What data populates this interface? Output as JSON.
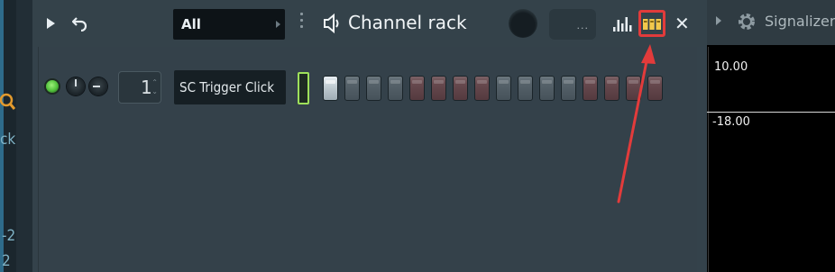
{
  "left_panel": {
    "partial_text_top": "ck",
    "partial_text_a": "-2",
    "partial_text_b": "2"
  },
  "channel_rack": {
    "filter_value": "All",
    "title": "Channel rack",
    "swing_text": "···"
  },
  "channel": {
    "number": "1",
    "name": "SC Trigger Click",
    "steps": [
      {
        "state": "on",
        "color": "grey"
      },
      {
        "state": "off",
        "color": "grey"
      },
      {
        "state": "off",
        "color": "grey"
      },
      {
        "state": "off",
        "color": "grey"
      },
      {
        "state": "off",
        "color": "red"
      },
      {
        "state": "off",
        "color": "red"
      },
      {
        "state": "off",
        "color": "red"
      },
      {
        "state": "off",
        "color": "red"
      },
      {
        "state": "off",
        "color": "grey"
      },
      {
        "state": "off",
        "color": "grey"
      },
      {
        "state": "off",
        "color": "grey"
      },
      {
        "state": "off",
        "color": "grey"
      },
      {
        "state": "off",
        "color": "red"
      },
      {
        "state": "off",
        "color": "red"
      },
      {
        "state": "off",
        "color": "red"
      },
      {
        "state": "off",
        "color": "red"
      }
    ]
  },
  "signalizer": {
    "title": "Signalizer",
    "value_top": "10.00",
    "value_bottom": "-18.00"
  },
  "colors": {
    "led_green": "#5fd040",
    "selection_green": "#9ee05a",
    "highlight_red": "#e23b3b",
    "graph_icon_yellow": "#f2c94c"
  }
}
